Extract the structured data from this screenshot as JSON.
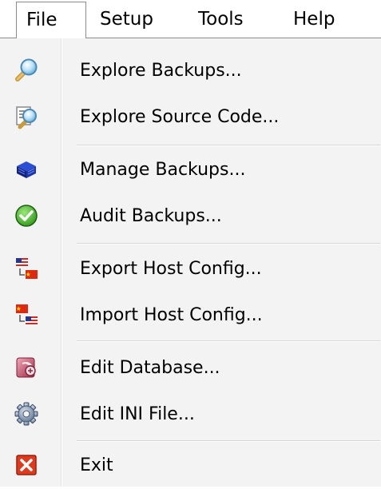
{
  "menubar": {
    "items": [
      {
        "label": "File"
      },
      {
        "label": "Setup"
      },
      {
        "label": "Tools"
      },
      {
        "label": "Help"
      }
    ]
  },
  "file_menu": {
    "groups": [
      [
        {
          "label": "Explore Backups...",
          "icon": "magnifier-icon"
        },
        {
          "label": "Explore Source Code...",
          "icon": "source-code-search-icon"
        }
      ],
      [
        {
          "label": "Manage Backups...",
          "icon": "backup-stack-icon"
        },
        {
          "label": "Audit Backups...",
          "icon": "checkmark-circle-icon"
        }
      ],
      [
        {
          "label": "Export Host Config...",
          "icon": "export-flags-icon"
        },
        {
          "label": "Import Host Config...",
          "icon": "import-flags-icon"
        }
      ],
      [
        {
          "label": "Edit Database...",
          "icon": "database-icon"
        },
        {
          "label": "Edit INI File...",
          "icon": "gear-icon"
        }
      ],
      [
        {
          "label": "Exit",
          "icon": "close-icon"
        }
      ]
    ]
  },
  "colors": {
    "menu_background": "#f3f3f3",
    "menubar_background": "#ffffff",
    "separator": "#d6d6d6",
    "check_green": "#3cb521",
    "exit_red": "#e03a1e"
  }
}
